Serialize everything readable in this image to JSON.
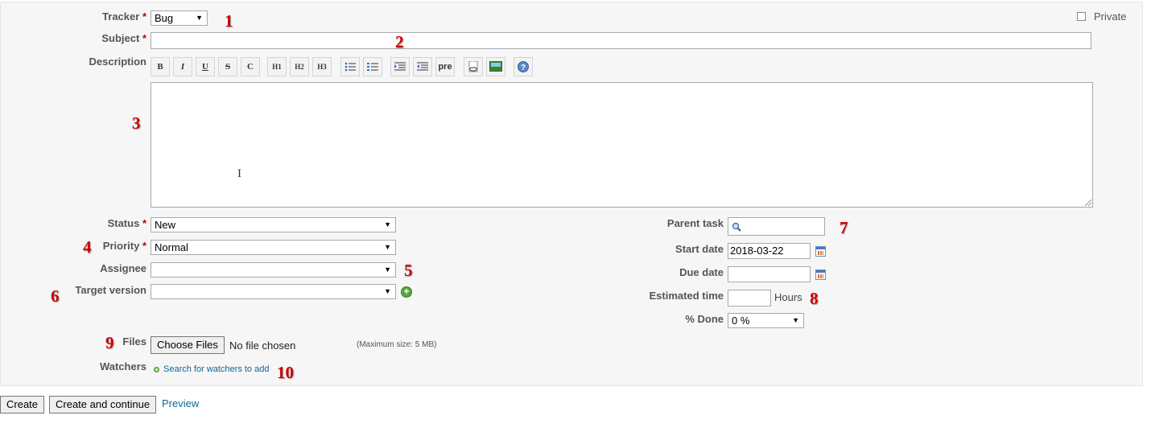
{
  "form": {
    "tracker": {
      "label": "Tracker",
      "required_mark": "*",
      "value": "Bug"
    },
    "private": {
      "label": "Private",
      "checked": false
    },
    "subject": {
      "label": "Subject",
      "required_mark": "*",
      "value": ""
    },
    "description": {
      "label": "Description",
      "value": ""
    },
    "toolbar": [
      "B",
      "I",
      "U",
      "S",
      "C",
      "H1",
      "H2",
      "H3",
      "ul",
      "ol",
      "indent-right",
      "indent-left",
      "pre",
      "link",
      "image",
      "help"
    ],
    "status": {
      "label": "Status",
      "required_mark": "*",
      "value": "New"
    },
    "priority": {
      "label": "Priority",
      "required_mark": "*",
      "value": "Normal"
    },
    "assignee": {
      "label": "Assignee",
      "value": ""
    },
    "target_version": {
      "label": "Target version",
      "value": ""
    },
    "parent_task": {
      "label": "Parent task",
      "value": ""
    },
    "start_date": {
      "label": "Start date",
      "value": "2018-03-22"
    },
    "due_date": {
      "label": "Due date",
      "value": ""
    },
    "estimated_time": {
      "label": "Estimated time",
      "value": "",
      "unit": "Hours"
    },
    "done": {
      "label": "% Done",
      "value": "0 %"
    },
    "files": {
      "label": "Files",
      "button": "Choose Files",
      "status": "No file chosen",
      "max_size": "(Maximum size: 5 MB)"
    },
    "watchers": {
      "label": "Watchers",
      "link": "Search for watchers to add"
    }
  },
  "toolbar_text": {
    "pre": "pre"
  },
  "annotations": [
    "1",
    "2",
    "3",
    "4",
    "5",
    "6",
    "7",
    "8",
    "9",
    "10"
  ],
  "actions": {
    "create": "Create",
    "create_continue": "Create and continue",
    "preview": "Preview"
  }
}
